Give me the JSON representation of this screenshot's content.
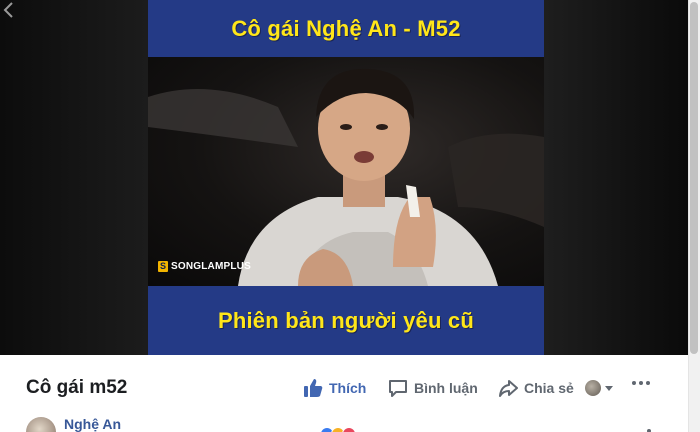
{
  "video": {
    "top_banner": "Cô gái Nghệ An - M52",
    "bottom_banner": "Phiên bản người yêu cũ",
    "watermark": "SONGLAMPLUS",
    "watermark_logo": "S"
  },
  "post": {
    "title": "Cô gái m52",
    "poster_name": "Nghệ An"
  },
  "actions": {
    "like_label": "Thích",
    "comment_label": "Bình luận",
    "share_label": "Chia sẻ"
  },
  "colors": {
    "banner": "#243a86",
    "banner_text": "#ffe619",
    "link_blue": "#4267b2",
    "muted": "#606770"
  },
  "icons": [
    "chevron-left-icon",
    "like-icon",
    "comment-icon",
    "share-icon",
    "globe-icon",
    "caret-down-icon",
    "more-icon"
  ]
}
